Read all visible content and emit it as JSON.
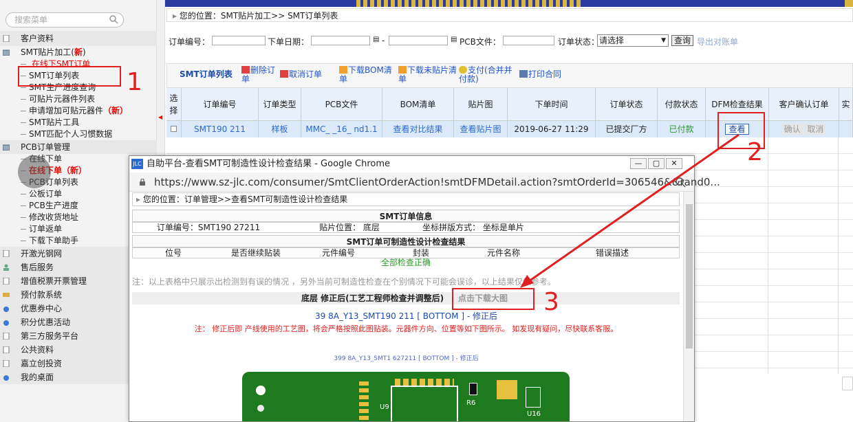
{
  "sidebar": {
    "search_placeholder": "搜索菜单",
    "items": [
      {
        "label": "客户资料"
      },
      {
        "label": "SMT贴片加工(",
        "badge": "新",
        "tail": ")"
      },
      {
        "label": "PCB订单管理"
      },
      {
        "label": "开激光钢网"
      },
      {
        "label": "售后服务"
      },
      {
        "label": "增值税票开票管理"
      },
      {
        "label": "预付款系统"
      },
      {
        "label": "优惠券中心"
      },
      {
        "label": "积分优惠活动"
      },
      {
        "label": "第三方服务平台"
      },
      {
        "label": "公共资料"
      },
      {
        "label": "嘉立创投资"
      },
      {
        "label": "我的桌面"
      }
    ],
    "smt_sub": [
      "在线下SMT订单",
      "SMT订单列表",
      "SMT生产进度查询",
      "可贴片元器件列表",
      "申请增加可贴元器件",
      "SMT贴片工具",
      "SMT匹配个人习惯数据"
    ],
    "smt_sub_new": "（新）",
    "pcb_sub": [
      "在线下单",
      "在线下单（新）",
      "PCB订单列表",
      "公板订单",
      "PCB生产进度",
      "修改收货地址",
      "订单返单",
      "下载下单助手"
    ]
  },
  "breadcrumb": "您的位置：SMT贴片加工>> SMT订单列表",
  "filters": {
    "order_no": "订单编号：",
    "date": "下单日期：",
    "dash": "-",
    "pcb_file": "PCB文件：",
    "status": "订单状态：",
    "status_value": "请选择",
    "query": "查询",
    "export": "导出对账单"
  },
  "toolbar": {
    "title": "SMT订单列表",
    "delete": "删除订单",
    "cancel": "取消订单",
    "bom": "下载BOM清单",
    "unplaced": "下载未贴片清单",
    "pay": "支付(合并并付款)",
    "print": "打印合同"
  },
  "table": {
    "headers": [
      "选择",
      "订单编号",
      "订单类型",
      "PCB文件",
      "BOM清单",
      "贴片图",
      "下单时间",
      "订单状态",
      "付款状态",
      "DFM检查结果",
      "客户确认订单",
      "实"
    ],
    "row": {
      "order_no": "SMT190      211",
      "type": "样板",
      "pcb": "MMC_  _16_  nd1.1",
      "bom": "查看对比结果",
      "chip": "查看贴片图",
      "time": "2019-06-27 11:29",
      "status": "已提交厂方",
      "pay": "已付款",
      "dfm": "查看",
      "confirm": "确认",
      "cancel": "取消"
    }
  },
  "popup": {
    "title": "自助平台-查看SMT可制造性设计检查结果 - Google Chrome",
    "logo": "JLC",
    "url": "https://www.sz-jlc.com/consumer/SmtClientOrderAction!smtDFMDetail.action?smtOrderId=306546&&rand0...",
    "breadcrumb": "您的位置：订单管理>>查看SMT可制造性设计检查结果",
    "info_title": "SMT订单信息",
    "info_order": "订单编号：SMT190 27211",
    "info_pos": "贴片位置：  底层",
    "info_coord": "坐标拼版方式：  坐标是单片",
    "result_title": "SMT订单可制造性设计检查结果",
    "cols": [
      "位号",
      "是否继续贴装",
      "元件编号",
      "封装",
      "元件名称",
      "错误描述"
    ],
    "all_ok": "全部检查正确",
    "note": "注：以上表格中只展示出检测到有误的情况 ，另外当前可制造性检查在个别情况下可能会误诊，以上结果仅供参考。",
    "bottom_label": "底层  修正后(工艺工程师检查并调整后)",
    "download": "点击下载大图",
    "file_link": "39    8A_Y13_SMT190      211  [  BOTTOM  ]  -  修正后",
    "red_note": "注：  修正后即 产线使用的工艺图，将会严格按照此图贴装。元器件方向、位置等如下图所示。 如发现有疑问，尽快联系客服。",
    "small_caption": "399  8A_Y13_SMT1  627211 [ BOTTOM ] - 修正后",
    "pcb_labels": [
      "U9",
      "R6",
      "U16"
    ]
  },
  "annotations": [
    "1",
    "2",
    "3"
  ],
  "colors": {
    "red": "#e02020",
    "link": "#2255cc",
    "green": "#1e7a1e"
  }
}
